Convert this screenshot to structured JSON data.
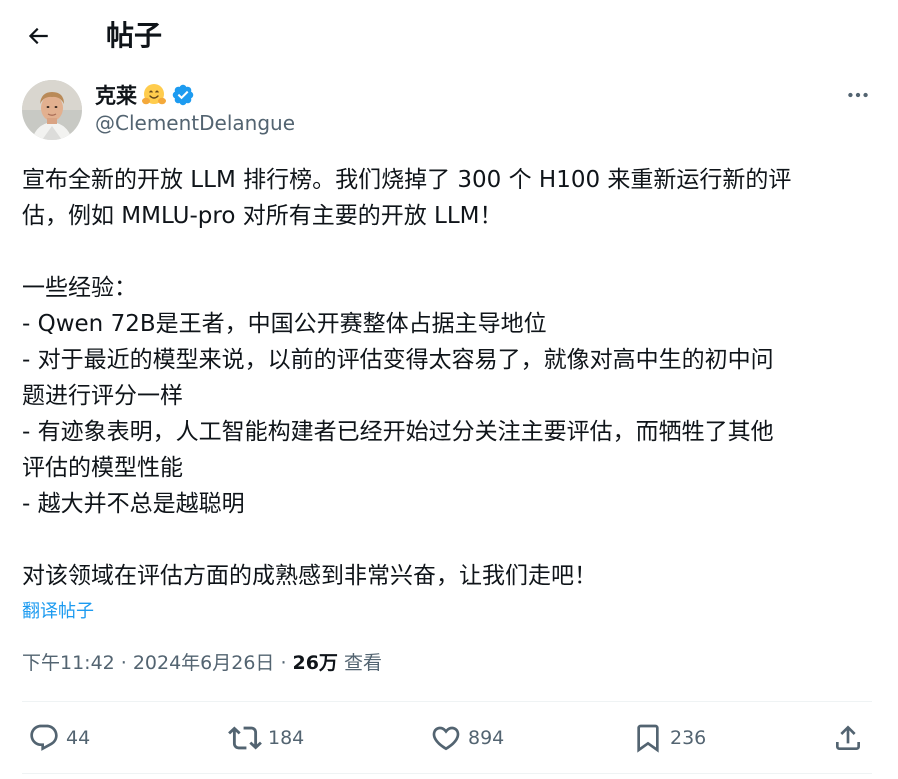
{
  "header": {
    "title": "帖子"
  },
  "author": {
    "display_name": "克莱",
    "emoji": "🤗",
    "handle": "@ClementDelangue",
    "verified": true
  },
  "tweet": {
    "lines": [
      "宣布全新的开放 LLM 排行榜。我们烧掉了 300 个 H100 来重新运行新的评",
      "估，例如 MMLU-pro 对所有主要的开放 LLM！",
      "",
      "一些经验：",
      "- Qwen 72B是王者，中国公开赛整体占据主导地位",
      "- 对于最近的模型来说，以前的评估变得太容易了，就像对高中生的初中问",
      "题进行评分一样",
      "- 有迹象表明，人工智能构建者已经开始过分关注主要评估，而牺牲了其他",
      "评估的模型性能",
      "- 越大并不总是越聪明",
      "",
      "对该领域在评估方面的成熟感到非常兴奋，让我们走吧！"
    ],
    "translate_label": "翻译帖子",
    "time": "下午11:42",
    "date": "2024年6月26日",
    "separator": "·",
    "views_count": "26万",
    "views_label": "查看"
  },
  "actions": {
    "replies": "44",
    "retweets": "184",
    "likes": "894",
    "bookmarks": "236"
  },
  "colors": {
    "accent": "#1d9bf0",
    "text": "#0f1419",
    "secondary": "#536471"
  }
}
